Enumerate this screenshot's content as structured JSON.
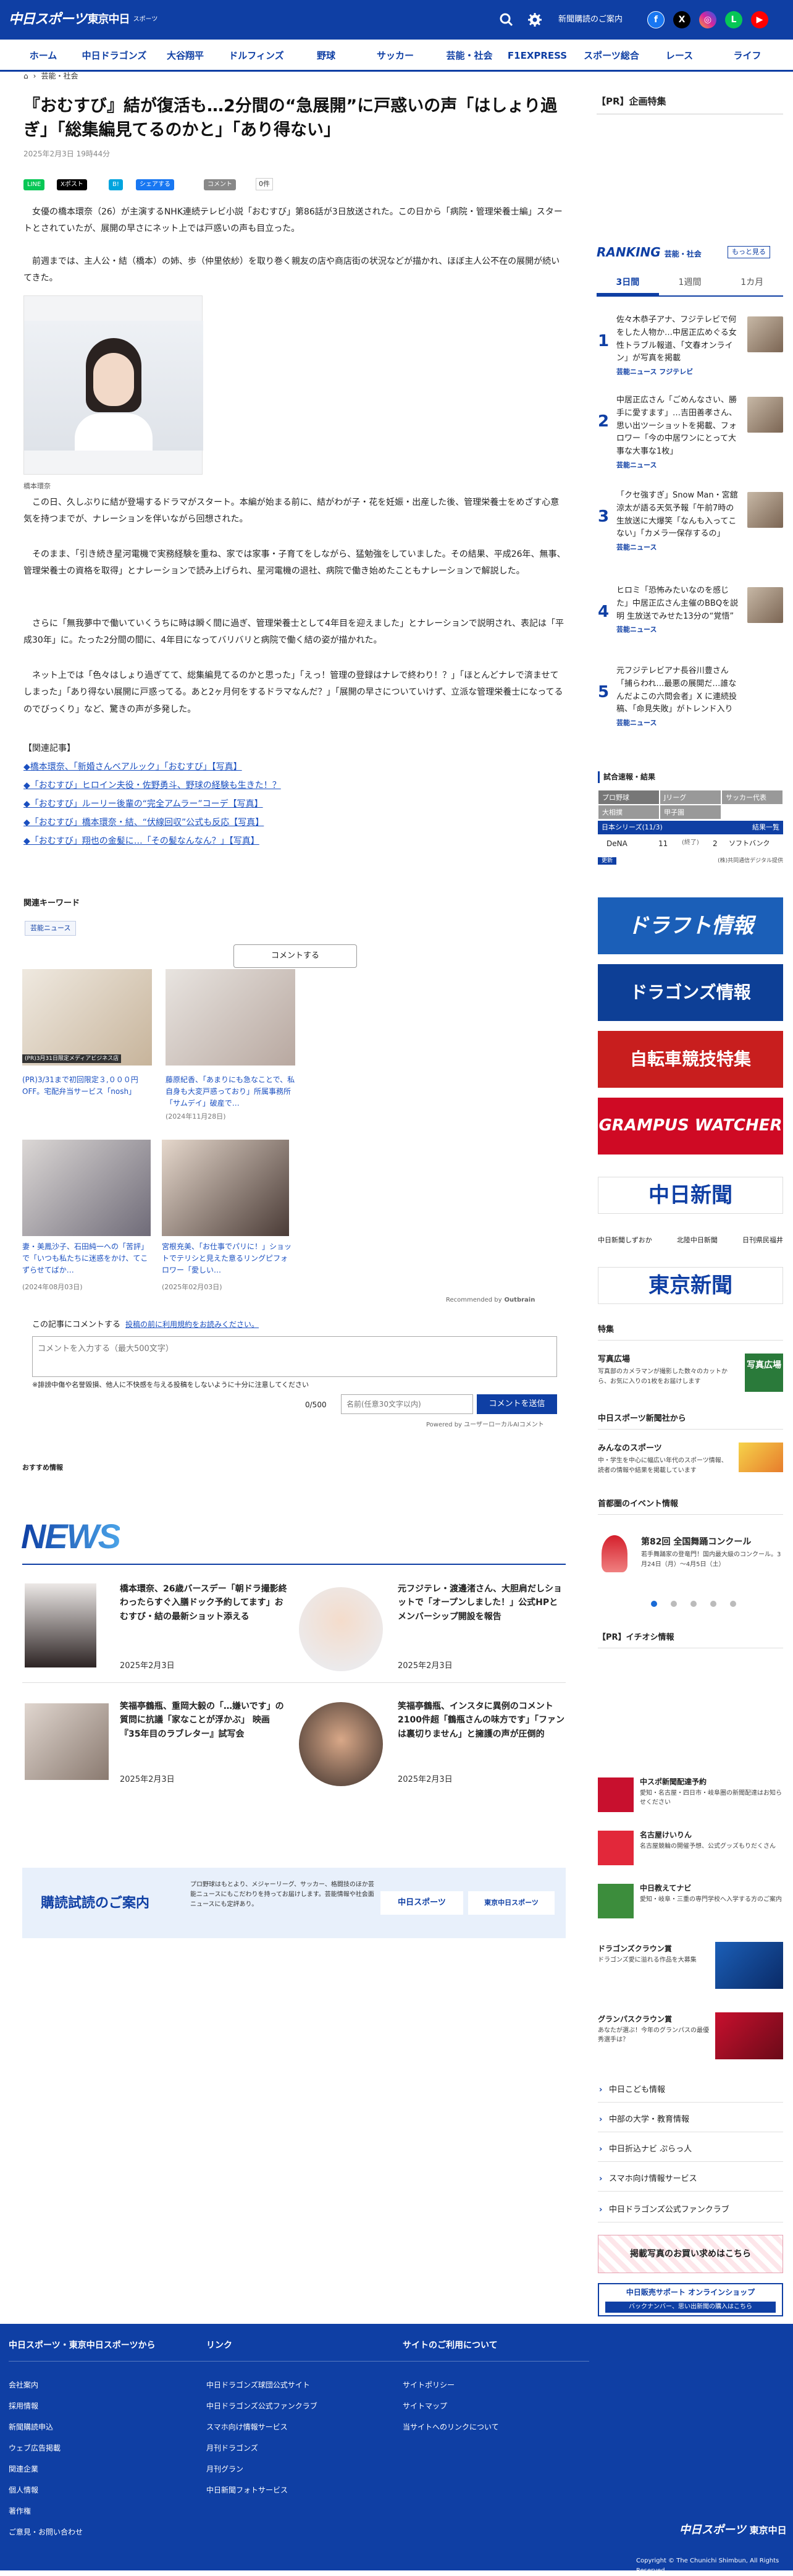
{
  "header": {
    "logo_main": "中日スポーツ",
    "logo_sub": "東京中日",
    "logo_small": "スポーツ",
    "subscribe_guide": "新聞購読のご案内"
  },
  "nav": [
    "ホーム",
    "中日ドラゴンズ",
    "大谷翔平",
    "ドルフィンズ",
    "野球",
    "サッカー",
    "芸能・社会",
    "F1EXPRESS",
    "スポーツ総合",
    "レース",
    "ライフ"
  ],
  "breadcrumb": {
    "home": "ホーム",
    "category": "芸能・社会"
  },
  "article": {
    "title": "『おむすび』結が復活も…2分間の“急展開”に戸惑いの声「はしょり過ぎ」「総集編見てるのかと」「あり得ない」",
    "date": "2025年2月3日 19時44分",
    "share_line": "LINE",
    "share_x": "Xポスト",
    "share_b": "B!",
    "share_fb": "シェアする",
    "share_comment": "コメント",
    "comment_count": "0件",
    "p1": "女優の橋本環奈（26）が主演するNHK連続テレビ小説「おむすび」第86話が3日放送された。この日から「病院・管理栄養士編」スタートとされていたが、展開の早さにネット上では戸惑いの声も目立った。",
    "p2": "前週までは、主人公・結（橋本）の姉、歩（仲里依紗）を取り巻く親友の店や商店街の状況などが描かれ、ほぼ主人公不在の展開が続いてきた。",
    "photo_caption": "橋本環奈",
    "p3": "この日、久しぶりに結が登場するドラマがスタート。本編が始まる前に、結がわが子・花を妊娠・出産した後、管理栄養士をめざす心意気を持つまでが、ナレーションを伴いながら回想された。",
    "p4": "そのまま、「引き続き星河電機で実務経験を重ね、家では家事・子育てをしながら、猛勉強をしていました。その結果、平成26年、無事、管理栄養士の資格を取得」とナレーションで読み上げられ、星河電機の退社、病院で働き始めたこともナレーションで解説した。",
    "p5": "さらに「無我夢中で働いていくうちに時は瞬く間に過ぎ、管理栄養士として4年目を迎えました」とナレーションで説明され、表記は「平成30年」に。たった2分間の間に、4年目になってバリバリと病院で働く結の姿が描かれた。",
    "p6": "ネット上では「色々はしょり過ぎてて、総集編見てるのかと思った」「えっ！管理の登録はナレで終わり！？」「ほとんどナレで済ませてしまった」「あり得ない展開に戸惑ってる。あと2ヶ月何をするドラマなんだ？」「展開の早さについていけず、立派な管理栄養士になってるのでびっくり」など、驚きの声が多発した。",
    "related_heading": "【関連記事】",
    "related": [
      "◆橋本環奈、「新婚さんベアルック」「おむすび」【写真】",
      "◆「おむすび」ヒロイン夫役・佐野勇斗、野球の経験も生きた！？",
      "◆「おむすび」ルーリー後輩の“完全アムラー”コーデ【写真】",
      "◆「おむすび」橋本環奈・結、“伏線回収”公式も反応【写真】",
      "◆「おむすび」翔也の金髪に…「その髪なんなん？」【写真】"
    ],
    "keyword_heading": "関連キーワード",
    "keyword": "芸能ニュース",
    "comment_button": "コメントする"
  },
  "recommend": {
    "items": [
      {
        "text": "(PR)3/31まで初回限定３,０００円OFF。宅配弁当サービス「nosh」",
        "tag": "(PR)3月31日限定メディアビジネス店"
      },
      {
        "text": "藤原紀香、「あまりにも急なことで、私自身も大変戸惑っており」所属事務所「サムデイ」破産で…",
        "date": "(2024年11月28日)"
      },
      {
        "text": "妻・美鳳沙子、石田純一への「苦評」で「いつも私たちに迷惑をかけ、てこずらせてばか…",
        "date": "(2024年08月03日)"
      },
      {
        "text": "宮根充美、「お仕事でパリに！」ショットでテリシと見えた意るリングピフォロワー「愛しい…",
        "date": "(2025年02月03日)"
      }
    ],
    "powered": "Recommended by",
    "powered_brand": "Outbrain"
  },
  "comment_form": {
    "heading": "この記事にコメントする",
    "rules_link": "投稿の前に利用規約をお読みください。",
    "placeholder": "コメントを入力する（最大500文字）",
    "note": "※誹謗中傷や名誉毀損、他人に不快感を与える投稿をしないように十分に注意してください",
    "count": "0/500",
    "name_placeholder": "名前(任意30文字以内)",
    "submit": "コメントを送信",
    "powered": "Powered by ユーザーローカルAIコメント"
  },
  "osusume": "おすすめ情報",
  "news": {
    "heading": "NEWS",
    "items": [
      {
        "title": "橋本環奈、26歳バースデー「朝ドラ撮影終わったらすぐ入膳ドック予約してます」おむすび・結の最新ショット添える",
        "date": "2025年2月3日"
      },
      {
        "title": "元フジテレ・渡邊渚さん、大胆肩だしショットで「オープンしました！」公式HPとメンバーシップ開設を報告",
        "date": "2025年2月3日"
      },
      {
        "title": "笑福亭鶴瓶、重岡大毅の「…嫌いです」の質問に抗議「家なことが浮かぶ」 映画『35年目のラブレター』試写会",
        "date": "2025年2月3日"
      },
      {
        "title": "笑福亭鶴瓶、インスタに異例のコメント2100件超「鶴瓶さんの味方です」「ファンは裏切りません」と擁護の声が圧倒的",
        "date": "2025年2月3日"
      }
    ]
  },
  "subscribe_banner": {
    "heading": "購読試読のご案内",
    "text": "プロ野球はもとより、メジャーリーグ、サッカー、格闘技のほか芸能ニュースにもこだわりを持ってお届けします。芸能情報や社会面ニュースにも定評あり。",
    "logo1": "中日スポーツ",
    "logo2": "東京中日スポーツ"
  },
  "sidebar": {
    "pr_heading": "【PR】企画特集",
    "ranking_title": "RANKING",
    "ranking_cat": "芸能・社会",
    "more": "もっと見る",
    "tabs": [
      "3日間",
      "1週間",
      "1カ月"
    ],
    "ranking": [
      {
        "num": "1",
        "text": "佐々木恭子アナ、フジテレビで何をした人物か…中居正広めぐる女性トラブル報道、「文春オンライン」が写真を掲載",
        "cat": "芸能ニュース フジテレビ"
      },
      {
        "num": "2",
        "text": "中居正広さん「ごめんなさい、勝手に愛すます」…吉田善孝さん、思い出ツーショットを掲載、フォロワー「今の中居ワンにとって大事な大事な1枚」",
        "cat": "芸能ニュース"
      },
      {
        "num": "3",
        "text": "「クセ強すぎ」Snow Man・宮舘涼太が語る天気予報「午前7時の生放送に大爆笑「なんも入ってこない」「カメラ一保存するの」",
        "cat": "芸能ニュース"
      },
      {
        "num": "4",
        "text": "ヒロミ「恐怖みたいなのを感じた」中居正広さん主催のBBQを説明 生放送でみせた13分の“覚悟”",
        "cat": "芸能ニュース"
      },
      {
        "num": "5",
        "text": "元フジテレビアナ長谷川豊さん「捕らわれ…最悪の展開だ…誰なんだよこの六問会者」X に連続投稿、「命見失敗」がトレンド入り",
        "cat": "芸能ニュース"
      }
    ],
    "score_heading": "試合速報・結果",
    "score_tabs": [
      "プロ野球",
      "Jリーグ",
      "サッカー代表",
      "大相撲",
      "甲子園"
    ],
    "score_header": "日本シリーズ(11/3)",
    "score_status": "結果一覧",
    "score_team1": "DeNA",
    "score_team2": "ソフトバンク",
    "score_s1": "11",
    "score_s2": "2",
    "score_mid": "(終了)",
    "score_update": "更新",
    "score_credit": "(株)共同通信デジタル提供",
    "banners": [
      "ドラフト情報",
      "ドラゴンズ情報",
      "自転車競技特集",
      "GRAMPUS WATCHER"
    ],
    "chunichi_shimbun": "中日新聞",
    "shimbun_links": [
      "中日新聞しずおか",
      "北陸中日新聞",
      "日刊県民福井"
    ],
    "tokyo_shimbun": "東京新聞",
    "tokushu_heading": "特集",
    "tokushu_title": "写真広場",
    "tokushu_text": "写真部のカメラマンが撮影した数々のカットから、お気に入りの1枚をお届けします",
    "tokushu_badge": "写真広場",
    "recommend_heading": "中日スポーツ新聞社から",
    "recommend_title": "みんなのスポーツ",
    "recommend_text": "中・学生を中心に幅広い年代のスポーツ情報、読者の情報や結果を掲載しています",
    "event_heading": "首都圏のイベント情報",
    "event_title": "第82回 全国舞踊コンクール",
    "event_text": "若手舞踊家の登竜門！国内最大級のコンクール。3月24日（月）〜4月5日（土）",
    "pr_event": "【PR】イチオシ情報",
    "pr_items": [
      {
        "title": "中スポ新聞配達予約",
        "text": "愛知・名古屋・四日市・岐阜圏の新聞配達はお知らせください"
      },
      {
        "title": "名古屋けいりん",
        "text": "名古屋競輪の開催予想、公式グッズもりだくさん"
      },
      {
        "title": "中日教えてナビ",
        "text": "愛知・岐阜・三重の専門学校へ入学する方のご案内"
      },
      {
        "title": "ドラゴンズクラウン賞",
        "text": "ドラゴンズ愛に溢れる作品を大募集"
      },
      {
        "title": "グランパスクラウン賞",
        "text": "あなたが選ぶ！今年のグランパスの最優秀選手は？"
      }
    ],
    "links": [
      "中日こども情報",
      "中部の大学・教育情報",
      "中日折込ナビ ぷらっ人",
      "スマホ向け情報サービス",
      "中日ドラゴンズ公式ファンクラブ"
    ],
    "photo_service": "掲載写真のお買い求めはこちら",
    "shop": "中日販売サポート オンラインショップ",
    "shop_sub": "バックナンバー、思い出新聞の購入はこちら"
  },
  "footer": {
    "col1_heading": "中日スポーツ・東京中日スポーツから",
    "col1": [
      "会社案内",
      "採用情報",
      "新聞購読申込",
      "ウェブ広告掲載",
      "関連企業",
      "個人情報",
      "著作権",
      "ご意見・お問い合わせ"
    ],
    "col2_heading": "リンク",
    "col2": [
      "中日ドラゴンズ球団公式サイト",
      "中日ドラゴンズ公式ファンクラブ",
      "スマホ向け情報サービス",
      "月刊ドラゴンズ",
      "月刊グラン",
      "中日新聞フォトサービス"
    ],
    "col3_heading": "サイトのご利用について",
    "col3": [
      "サイトポリシー",
      "サイトマップ",
      "当サイトへのリンクについて"
    ],
    "copyright": "Copyright © The Chunichi Shimbun, All Rights Reserved."
  },
  "colors": {
    "brand": "#0f3fa4",
    "accent": "#e60012"
  }
}
